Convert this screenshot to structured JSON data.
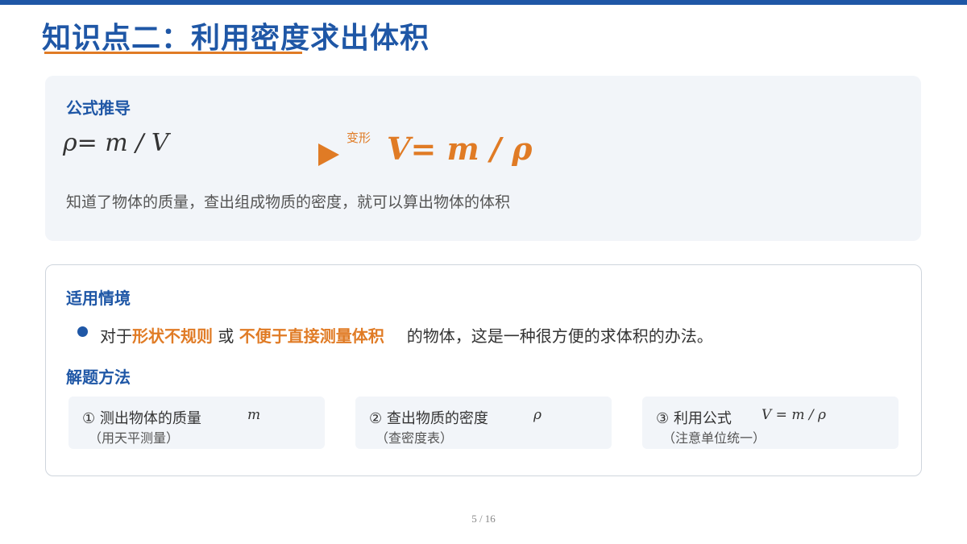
{
  "title": "知识点二：利用密度求出体积",
  "derivation": {
    "heading": "公式推导",
    "formula_original": "ρ=  m / V",
    "transform_label": "变形",
    "formula_transformed": "V=  m / ρ",
    "description": "知道了物体的质量，查出组成物质的密度，就可以算出物体的体积"
  },
  "application": {
    "heading": "适用情境",
    "bullet": {
      "prefix": "对于",
      "highlight1": "形状不规则",
      "connector": " 或 ",
      "highlight2": "不便于直接测量体积",
      "suffix": "的物体，这是一种很方便的求体积的办法。"
    },
    "method_heading": "解题方法",
    "steps": [
      {
        "title": "① 测出物体的质量",
        "symbol": "m",
        "note": "（用天平测量）"
      },
      {
        "title": "② 查出物质的密度",
        "symbol": "ρ",
        "note": "（查密度表）"
      },
      {
        "title": "③ 利用公式",
        "symbol": "V = m / ρ",
        "note": "（注意单位统一）"
      }
    ]
  },
  "footer": {
    "page": "5 / 16"
  },
  "colors": {
    "primary": "#1f57a6",
    "accent": "#e07b25",
    "card_bg": "#f2f5f9"
  }
}
